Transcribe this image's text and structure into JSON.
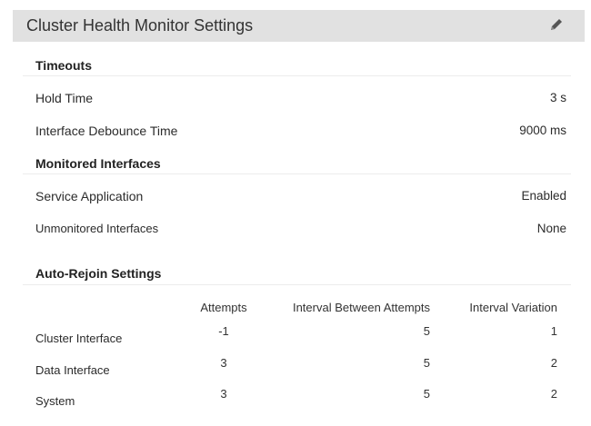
{
  "header": {
    "title": "Cluster Health Monitor Settings",
    "edit_icon": "pencil-icon"
  },
  "timeouts": {
    "title": "Timeouts",
    "hold_time_label": "Hold Time",
    "hold_time_value": "3 s",
    "debounce_label": "Interface Debounce Time",
    "debounce_value": "9000 ms"
  },
  "monitored": {
    "title": "Monitored Interfaces",
    "service_label": "Service Application",
    "service_value": "Enabled",
    "unmonitored_label": "Unmonitored Interfaces",
    "unmonitored_value": "None"
  },
  "auto_rejoin": {
    "title": "Auto-Rejoin Settings",
    "columns": [
      "Attempts",
      "Interval Between Attempts",
      "Interval Variation"
    ],
    "rows": [
      {
        "name": "Cluster Interface",
        "attempts": "-1",
        "interval": "5",
        "variation": "1"
      },
      {
        "name": "Data Interface",
        "attempts": "3",
        "interval": "5",
        "variation": "2"
      },
      {
        "name": "System",
        "attempts": "3",
        "interval": "5",
        "variation": "2"
      }
    ]
  }
}
